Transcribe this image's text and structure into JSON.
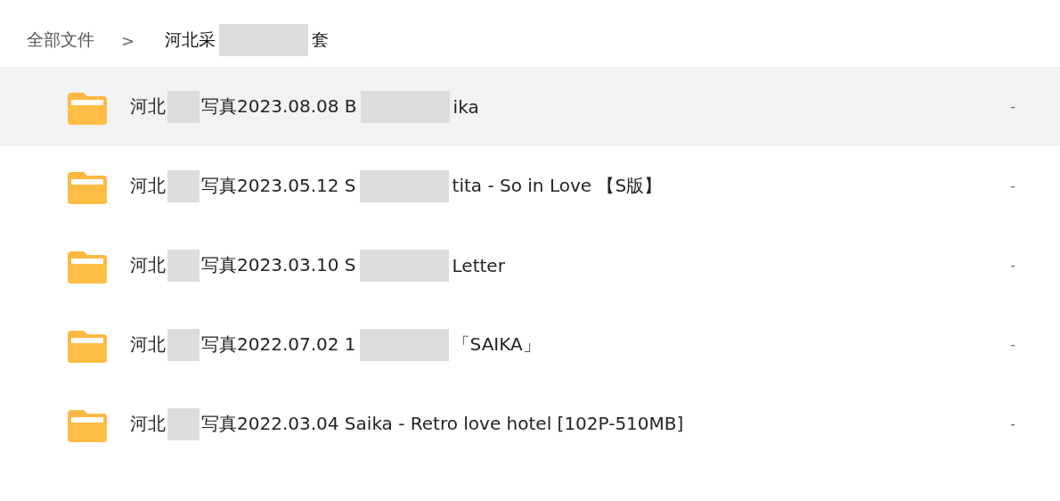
{
  "breadcrumb": {
    "root": "全部文件",
    "separator": ">",
    "current_parts": [
      "河北采",
      "套"
    ]
  },
  "files": [
    {
      "name_parts": [
        "河北",
        "写真2023.08.08 B",
        "ika"
      ],
      "size": "-",
      "selected": true
    },
    {
      "name_parts": [
        "河北",
        "写真2023.05.12 S",
        "tita - So in Love 【S版】"
      ],
      "size": "-",
      "selected": false
    },
    {
      "name_parts": [
        "河北",
        "写真2023.03.10 S",
        "Letter"
      ],
      "size": "-",
      "selected": false
    },
    {
      "name_parts": [
        "河北",
        "写真2022.07.02 1",
        "「SAIKA」"
      ],
      "size": "-",
      "selected": false
    },
    {
      "name_parts": [
        "河北",
        "写真2022.03.04 Saika - Retro love hotel [102P-510MB]"
      ],
      "size": "-",
      "selected": false
    }
  ]
}
